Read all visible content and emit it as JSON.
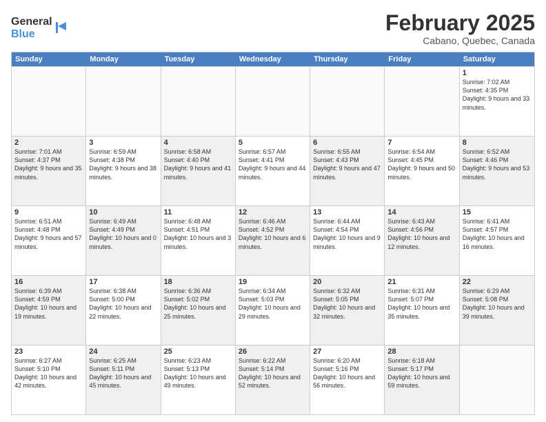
{
  "header": {
    "logo_general": "General",
    "logo_blue": "Blue",
    "month_title": "February 2025",
    "location": "Cabano, Quebec, Canada"
  },
  "days_of_week": [
    "Sunday",
    "Monday",
    "Tuesday",
    "Wednesday",
    "Thursday",
    "Friday",
    "Saturday"
  ],
  "rows": [
    [
      {
        "day": "",
        "text": "",
        "shaded": true,
        "empty": true
      },
      {
        "day": "",
        "text": "",
        "shaded": true,
        "empty": true
      },
      {
        "day": "",
        "text": "",
        "shaded": true,
        "empty": true
      },
      {
        "day": "",
        "text": "",
        "shaded": true,
        "empty": true
      },
      {
        "day": "",
        "text": "",
        "shaded": true,
        "empty": true
      },
      {
        "day": "",
        "text": "",
        "shaded": true,
        "empty": true
      },
      {
        "day": "1",
        "text": "Sunrise: 7:02 AM\nSunset: 4:35 PM\nDaylight: 9 hours and 33 minutes.",
        "shaded": false,
        "empty": false
      }
    ],
    [
      {
        "day": "2",
        "text": "Sunrise: 7:01 AM\nSunset: 4:37 PM\nDaylight: 9 hours and 35 minutes.",
        "shaded": true,
        "empty": false
      },
      {
        "day": "3",
        "text": "Sunrise: 6:59 AM\nSunset: 4:38 PM\nDaylight: 9 hours and 38 minutes.",
        "shaded": false,
        "empty": false
      },
      {
        "day": "4",
        "text": "Sunrise: 6:58 AM\nSunset: 4:40 PM\nDaylight: 9 hours and 41 minutes.",
        "shaded": true,
        "empty": false
      },
      {
        "day": "5",
        "text": "Sunrise: 6:57 AM\nSunset: 4:41 PM\nDaylight: 9 hours and 44 minutes.",
        "shaded": false,
        "empty": false
      },
      {
        "day": "6",
        "text": "Sunrise: 6:55 AM\nSunset: 4:43 PM\nDaylight: 9 hours and 47 minutes.",
        "shaded": true,
        "empty": false
      },
      {
        "day": "7",
        "text": "Sunrise: 6:54 AM\nSunset: 4:45 PM\nDaylight: 9 hours and 50 minutes.",
        "shaded": false,
        "empty": false
      },
      {
        "day": "8",
        "text": "Sunrise: 6:52 AM\nSunset: 4:46 PM\nDaylight: 9 hours and 53 minutes.",
        "shaded": true,
        "empty": false
      }
    ],
    [
      {
        "day": "9",
        "text": "Sunrise: 6:51 AM\nSunset: 4:48 PM\nDaylight: 9 hours and 57 minutes.",
        "shaded": false,
        "empty": false
      },
      {
        "day": "10",
        "text": "Sunrise: 6:49 AM\nSunset: 4:49 PM\nDaylight: 10 hours and 0 minutes.",
        "shaded": true,
        "empty": false
      },
      {
        "day": "11",
        "text": "Sunrise: 6:48 AM\nSunset: 4:51 PM\nDaylight: 10 hours and 3 minutes.",
        "shaded": false,
        "empty": false
      },
      {
        "day": "12",
        "text": "Sunrise: 6:46 AM\nSunset: 4:52 PM\nDaylight: 10 hours and 6 minutes.",
        "shaded": true,
        "empty": false
      },
      {
        "day": "13",
        "text": "Sunrise: 6:44 AM\nSunset: 4:54 PM\nDaylight: 10 hours and 9 minutes.",
        "shaded": false,
        "empty": false
      },
      {
        "day": "14",
        "text": "Sunrise: 6:43 AM\nSunset: 4:56 PM\nDaylight: 10 hours and 12 minutes.",
        "shaded": true,
        "empty": false
      },
      {
        "day": "15",
        "text": "Sunrise: 6:41 AM\nSunset: 4:57 PM\nDaylight: 10 hours and 16 minutes.",
        "shaded": false,
        "empty": false
      }
    ],
    [
      {
        "day": "16",
        "text": "Sunrise: 6:39 AM\nSunset: 4:59 PM\nDaylight: 10 hours and 19 minutes.",
        "shaded": true,
        "empty": false
      },
      {
        "day": "17",
        "text": "Sunrise: 6:38 AM\nSunset: 5:00 PM\nDaylight: 10 hours and 22 minutes.",
        "shaded": false,
        "empty": false
      },
      {
        "day": "18",
        "text": "Sunrise: 6:36 AM\nSunset: 5:02 PM\nDaylight: 10 hours and 25 minutes.",
        "shaded": true,
        "empty": false
      },
      {
        "day": "19",
        "text": "Sunrise: 6:34 AM\nSunset: 5:03 PM\nDaylight: 10 hours and 29 minutes.",
        "shaded": false,
        "empty": false
      },
      {
        "day": "20",
        "text": "Sunrise: 6:32 AM\nSunset: 5:05 PM\nDaylight: 10 hours and 32 minutes.",
        "shaded": true,
        "empty": false
      },
      {
        "day": "21",
        "text": "Sunrise: 6:31 AM\nSunset: 5:07 PM\nDaylight: 10 hours and 35 minutes.",
        "shaded": false,
        "empty": false
      },
      {
        "day": "22",
        "text": "Sunrise: 6:29 AM\nSunset: 5:08 PM\nDaylight: 10 hours and 39 minutes.",
        "shaded": true,
        "empty": false
      }
    ],
    [
      {
        "day": "23",
        "text": "Sunrise: 6:27 AM\nSunset: 5:10 PM\nDaylight: 10 hours and 42 minutes.",
        "shaded": false,
        "empty": false
      },
      {
        "day": "24",
        "text": "Sunrise: 6:25 AM\nSunset: 5:11 PM\nDaylight: 10 hours and 45 minutes.",
        "shaded": true,
        "empty": false
      },
      {
        "day": "25",
        "text": "Sunrise: 6:23 AM\nSunset: 5:13 PM\nDaylight: 10 hours and 49 minutes.",
        "shaded": false,
        "empty": false
      },
      {
        "day": "26",
        "text": "Sunrise: 6:22 AM\nSunset: 5:14 PM\nDaylight: 10 hours and 52 minutes.",
        "shaded": true,
        "empty": false
      },
      {
        "day": "27",
        "text": "Sunrise: 6:20 AM\nSunset: 5:16 PM\nDaylight: 10 hours and 56 minutes.",
        "shaded": false,
        "empty": false
      },
      {
        "day": "28",
        "text": "Sunrise: 6:18 AM\nSunset: 5:17 PM\nDaylight: 10 hours and 59 minutes.",
        "shaded": true,
        "empty": false
      },
      {
        "day": "",
        "text": "",
        "shaded": false,
        "empty": true
      }
    ]
  ]
}
